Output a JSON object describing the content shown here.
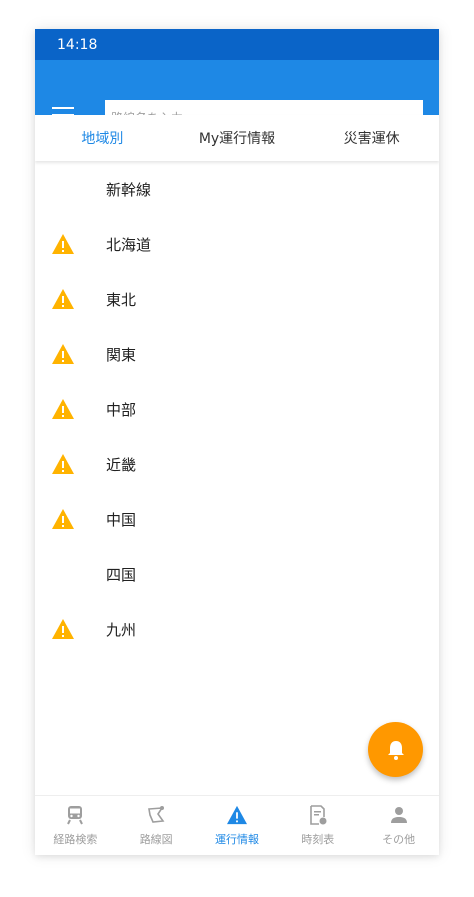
{
  "status_bar": {
    "time": "14:18"
  },
  "search": {
    "placeholder": "路線名を入力",
    "value": ""
  },
  "tabs": [
    {
      "label": "地域別",
      "active": true
    },
    {
      "label": "My運行情報",
      "active": false
    },
    {
      "label": "災害運休",
      "active": false
    }
  ],
  "regions": [
    {
      "label": "新幹線",
      "warning": false
    },
    {
      "label": "北海道",
      "warning": true
    },
    {
      "label": "東北",
      "warning": true
    },
    {
      "label": "関東",
      "warning": true
    },
    {
      "label": "中部",
      "warning": true
    },
    {
      "label": "近畿",
      "warning": true
    },
    {
      "label": "中国",
      "warning": true
    },
    {
      "label": "四国",
      "warning": false
    },
    {
      "label": "九州",
      "warning": true
    }
  ],
  "fab": {
    "icon": "bell-icon"
  },
  "bottom_nav": [
    {
      "label": "経路検索",
      "icon": "train-icon",
      "active": false
    },
    {
      "label": "路線図",
      "icon": "route-map-icon",
      "active": false
    },
    {
      "label": "運行情報",
      "icon": "warning-icon",
      "active": true
    },
    {
      "label": "時刻表",
      "icon": "timetable-icon",
      "active": false
    },
    {
      "label": "その他",
      "icon": "person-icon",
      "active": false
    }
  ],
  "colors": {
    "status_bar": "#0a64c8",
    "app_bar": "#1e88e5",
    "accent": "#1e88e5",
    "warning": "#ffb300",
    "fab": "#ff9800",
    "inactive": "#9e9e9e"
  }
}
